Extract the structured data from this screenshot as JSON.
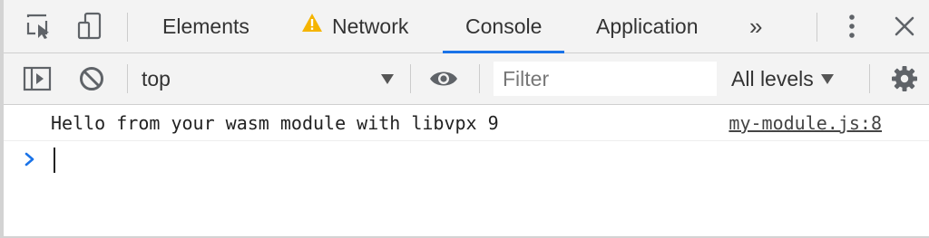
{
  "tabbar": {
    "icons": [
      "inspect-element-icon",
      "device-toolbar-icon",
      "more-tabs-icon",
      "kebab-menu-icon",
      "close-icon"
    ],
    "tabs": [
      {
        "label": "Elements",
        "active": false
      },
      {
        "label": "Network",
        "active": false,
        "warning": true
      },
      {
        "label": "Console",
        "active": true
      },
      {
        "label": "Application",
        "active": false
      }
    ],
    "overflow_label": "»"
  },
  "toolbar": {
    "icons": [
      "sidebar-toggle-icon",
      "clear-console-icon",
      "live-expression-eye-icon",
      "settings-gear-icon"
    ],
    "context": "top",
    "filter_placeholder": "Filter",
    "filter_value": "",
    "levels_label": "All levels"
  },
  "console": {
    "messages": [
      {
        "text": "Hello from your wasm module with libvpx 9",
        "source": "my-module.js:8"
      }
    ],
    "prompt_value": ""
  },
  "colors": {
    "accent": "#1a73e8",
    "warning": "#f5b400",
    "prompt_chevron": "#1a73e8",
    "toolbar_bg": "#f3f3f3"
  }
}
